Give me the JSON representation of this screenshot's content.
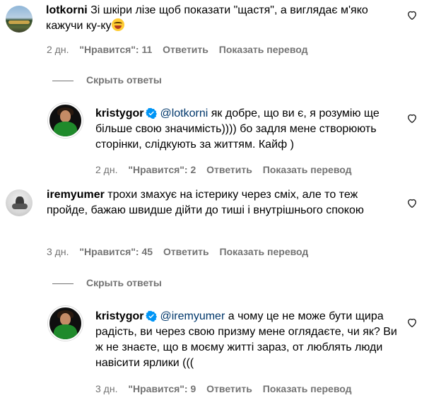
{
  "comments": [
    {
      "username": "lotkorni",
      "text": "Зі шкіри лізе щоб показати \"щастя\", а виглядає м'яко кажучи ку-ку",
      "time": "2 дн.",
      "likes": "\"Нравится\": 11",
      "reply": "Ответить",
      "translate": "Показать перевод",
      "hide_replies": "Скрыть ответы",
      "replies": [
        {
          "username": "kristygor",
          "mention": "@lotkorni",
          "text": " як добре, що ви є, я розумію ще більше свою значимість)))) бо задля мене створюють сторінки, слідкують за життям. Кайф )",
          "time": "2 дн.",
          "likes": "\"Нравится\": 2",
          "reply": "Ответить",
          "translate": "Показать перевод"
        }
      ]
    },
    {
      "username": "iremyumer",
      "text": "трохи змахує на істерику через сміх, але то теж пройде, бажаю швидше дійти до тиші і внутрішнього спокою",
      "time": "3 дн.",
      "likes": "\"Нравится\": 45",
      "reply": "Ответить",
      "translate": "Показать перевод",
      "hide_replies": "Скрыть ответы",
      "replies": [
        {
          "username": "kristygor",
          "mention": "@iremyumer",
          "text": " а чому це не може бути щира радість, ви через свою призму мене оглядаєте, чи як? Ви ж не знаєте, що в моєму житті зараз, от люблять люди навісити ярлики (((",
          "time": "3 дн.",
          "likes": "\"Нравится\": 9",
          "reply": "Ответить",
          "translate": "Показать перевод"
        }
      ]
    }
  ],
  "colors": {
    "meta": "#737373",
    "mention": "#00376b",
    "verified": "#0095f6"
  }
}
